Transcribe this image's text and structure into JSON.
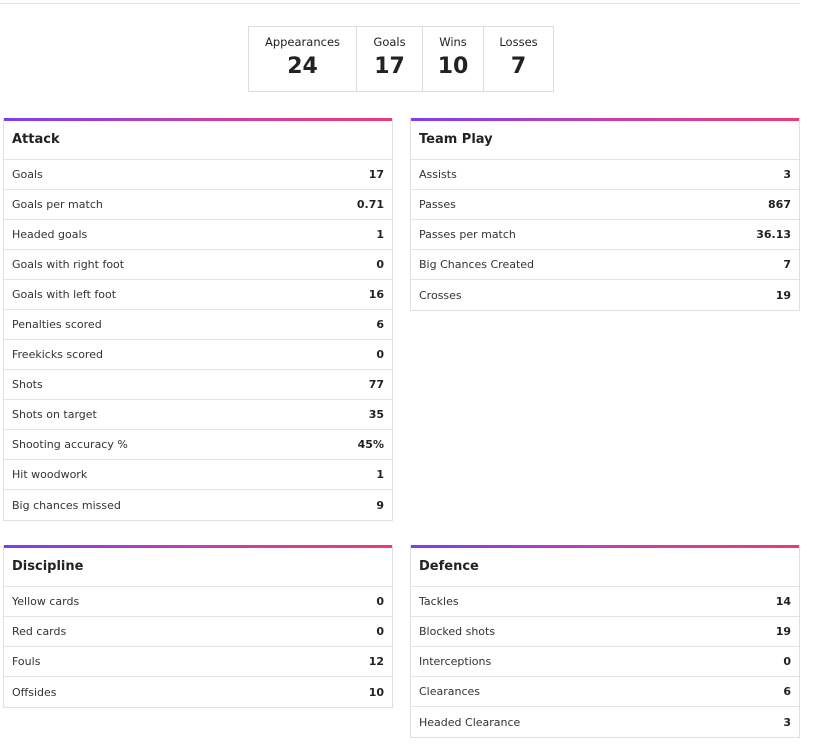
{
  "summary": [
    {
      "label": "Appearances",
      "value": "24"
    },
    {
      "label": "Goals",
      "value": "17"
    },
    {
      "label": "Wins",
      "value": "10"
    },
    {
      "label": "Losses",
      "value": "7"
    }
  ],
  "attack": {
    "title": "Attack",
    "rows": [
      {
        "label": "Goals",
        "value": "17"
      },
      {
        "label": "Goals per match",
        "value": "0.71"
      },
      {
        "label": "Headed goals",
        "value": "1"
      },
      {
        "label": "Goals with right foot",
        "value": "0"
      },
      {
        "label": "Goals with left foot",
        "value": "16"
      },
      {
        "label": "Penalties scored",
        "value": "6"
      },
      {
        "label": "Freekicks scored",
        "value": "0"
      },
      {
        "label": "Shots",
        "value": "77"
      },
      {
        "label": "Shots on target",
        "value": "35"
      },
      {
        "label": "Shooting accuracy %",
        "value": "45%"
      },
      {
        "label": "Hit woodwork",
        "value": "1"
      },
      {
        "label": "Big chances missed",
        "value": "9"
      }
    ]
  },
  "team_play": {
    "title": "Team Play",
    "rows": [
      {
        "label": "Assists",
        "value": "3"
      },
      {
        "label": "Passes",
        "value": "867"
      },
      {
        "label": "Passes per match",
        "value": "36.13"
      },
      {
        "label": "Big Chances Created",
        "value": "7"
      },
      {
        "label": "Crosses",
        "value": "19"
      }
    ]
  },
  "discipline": {
    "title": "Discipline",
    "rows": [
      {
        "label": "Yellow cards",
        "value": "0"
      },
      {
        "label": "Red cards",
        "value": "0"
      },
      {
        "label": "Fouls",
        "value": "12"
      },
      {
        "label": "Offsides",
        "value": "10"
      }
    ]
  },
  "defence": {
    "title": "Defence",
    "rows": [
      {
        "label": "Tackles",
        "value": "14"
      },
      {
        "label": "Blocked shots",
        "value": "19"
      },
      {
        "label": "Interceptions",
        "value": "0"
      },
      {
        "label": "Clearances",
        "value": "6"
      },
      {
        "label": "Headed Clearance",
        "value": "3"
      }
    ]
  },
  "colors": {
    "accent_start": "#7d3ef0",
    "accent_end": "#ec3a78",
    "border": "#e0e0e0"
  }
}
